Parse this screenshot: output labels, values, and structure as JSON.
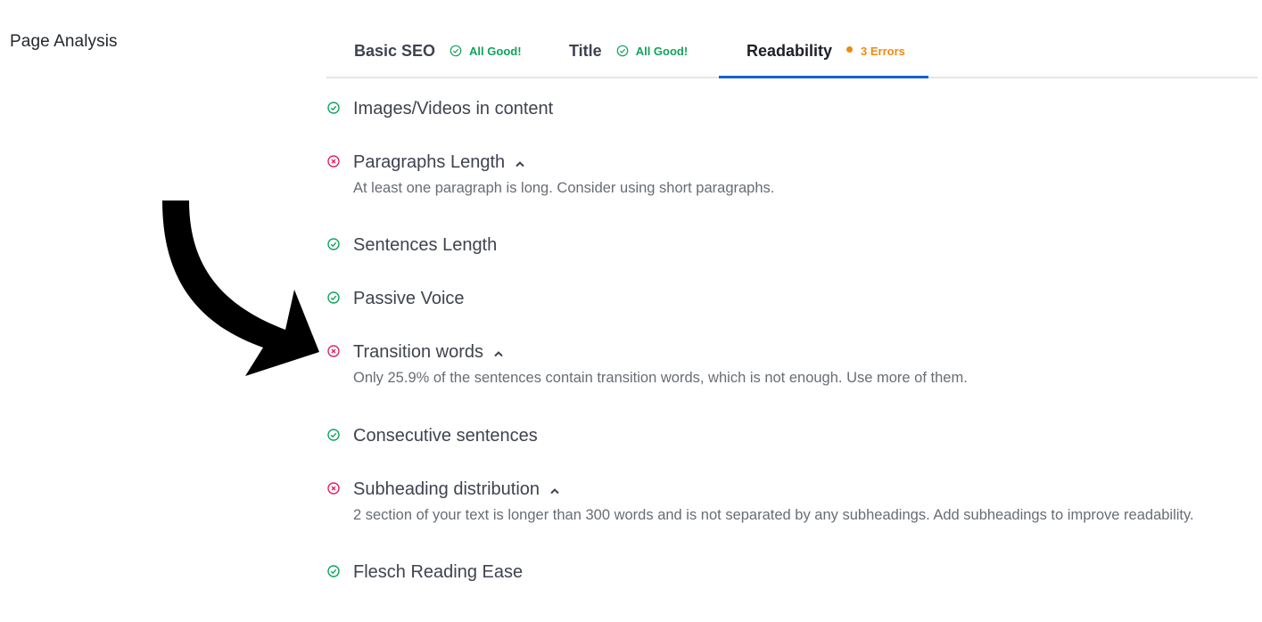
{
  "section_label": "Page Analysis",
  "colors": {
    "good": "#10a35d",
    "error": "#e0245e",
    "warning": "#ef8a12",
    "active_tab_underline": "#1061d6"
  },
  "tabs": [
    {
      "label": "Basic SEO",
      "status_text": "All Good!",
      "status": "good",
      "status_icon": "check-circle-icon",
      "active": false
    },
    {
      "label": "Title",
      "status_text": "All Good!",
      "status": "good",
      "status_icon": "check-circle-icon",
      "active": false
    },
    {
      "label": "Readability",
      "status_text": "3 Errors",
      "status": "error",
      "status_icon": "dot-icon",
      "active": true
    }
  ],
  "checks": [
    {
      "name": "Images/Videos in content",
      "status": "pass",
      "icon": "check-circle-icon"
    },
    {
      "name": "Paragraphs Length",
      "status": "fail",
      "icon": "x-circle-icon",
      "expanded": true,
      "chevron": "chevron-up-icon",
      "description": "At least one paragraph is long. Consider using short paragraphs."
    },
    {
      "name": "Sentences Length",
      "status": "pass",
      "icon": "check-circle-icon"
    },
    {
      "name": "Passive Voice",
      "status": "pass",
      "icon": "check-circle-icon"
    },
    {
      "name": "Transition words",
      "status": "fail",
      "icon": "x-circle-icon",
      "expanded": true,
      "chevron": "chevron-up-icon",
      "description": "Only 25.9% of the sentences contain transition words, which is not enough. Use more of them."
    },
    {
      "name": "Consecutive sentences",
      "status": "pass",
      "icon": "check-circle-icon"
    },
    {
      "name": "Subheading distribution",
      "status": "fail",
      "icon": "x-circle-icon",
      "expanded": true,
      "chevron": "chevron-up-icon",
      "description": "2 section of your text is longer than 300 words and is not separated by any subheadings. Add subheadings to improve readability."
    },
    {
      "name": "Flesch Reading Ease",
      "status": "pass",
      "icon": "check-circle-icon"
    }
  ],
  "annotation": {
    "icon": "curved-arrow-icon",
    "points_to": "Transition words"
  }
}
